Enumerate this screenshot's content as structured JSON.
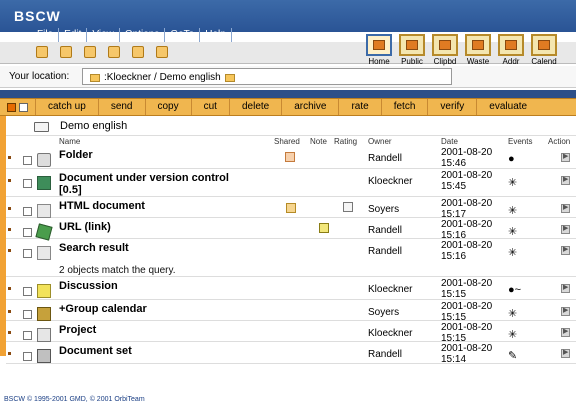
{
  "app": {
    "name": "BSCW",
    "menu": [
      "File",
      "Edit",
      "View",
      "Options",
      "GoTo",
      "Help"
    ]
  },
  "navigation": [
    {
      "label": "Home",
      "icon": "home-icon"
    },
    {
      "label": "Public",
      "icon": "public-icon"
    },
    {
      "label": "Clipbd",
      "icon": "clipboard-icon"
    },
    {
      "label": "Waste",
      "icon": "waste-icon"
    },
    {
      "label": "Addr",
      "icon": "address-book-icon"
    },
    {
      "label": "Calend",
      "icon": "calendar-icon"
    }
  ],
  "location": {
    "label": "Your location:",
    "path": ":Kloeckner / Demo english"
  },
  "actions": [
    "catch up",
    "send",
    "copy",
    "cut",
    "delete",
    "archive",
    "rate",
    "fetch",
    "verify",
    "evaluate"
  ],
  "folder": {
    "title": "Demo english"
  },
  "columns": [
    "Name",
    "Shared",
    "Note",
    "Rating",
    "Owner",
    "Date",
    "Events",
    "Action"
  ],
  "rows": [
    {
      "name": "Folder",
      "owner": "Randell",
      "date_line1": "2001-08-20",
      "date_line2": "15:46",
      "icon": "folder-icon"
    },
    {
      "name": "Document under version control",
      "name_line2": "[0.5]",
      "owner": "Kloeckner",
      "date_line1": "2001-08-20",
      "date_line2": "15:45",
      "icon": "document-icon"
    },
    {
      "name": "HTML document",
      "owner": "Soyers",
      "date_line1": "2001-08-20",
      "date_line2": "15:17",
      "icon": "html-icon"
    },
    {
      "name": "URL (link)",
      "owner": "Randell",
      "date_line1": "2001-08-20",
      "date_line2": "15:16",
      "icon": "url-icon"
    },
    {
      "name": "Search result",
      "subtext": "2 objects match the query.",
      "owner": "Randell",
      "date_line1": "2001-08-20",
      "date_line2": "15:16",
      "icon": "search-icon"
    },
    {
      "name": "Discussion",
      "owner": "Kloeckner",
      "date_line1": "2001-08-20",
      "date_line2": "15:15",
      "icon": "discussion-icon"
    },
    {
      "name": "+Group calendar",
      "owner": "Soyers",
      "date_line1": "2001-08-20",
      "date_line2": "15:15",
      "icon": "group-calendar-icon"
    },
    {
      "name": "Project",
      "owner": "Kloeckner",
      "date_line1": "2001-08-20",
      "date_line2": "15:15",
      "icon": "project-icon"
    },
    {
      "name": "Document set",
      "owner": "Randell",
      "date_line1": "2001-08-20",
      "date_line2": "15:14",
      "icon": "document-set-icon"
    }
  ],
  "footer": {
    "app": "BSCW",
    "copyright": "© 1995-2001 GMD, © 2001 OrbiTeam"
  },
  "colors": {
    "title_bar": "#2a5495",
    "action_bar": "#f0b64f",
    "sidebar": "#f1a234"
  }
}
